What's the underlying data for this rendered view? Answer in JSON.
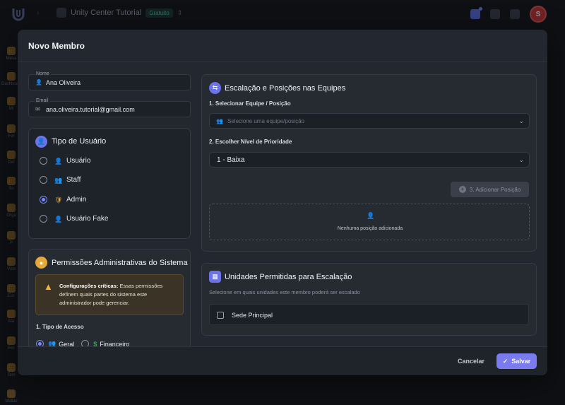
{
  "app": {
    "workspace_name": "Unity Center Tutorial",
    "plan_badge": "Gratuito",
    "avatar_initial": "S",
    "sidebar_items": [
      "Mesa",
      "Dashboard",
      "Mi",
      "Fer",
      "Def",
      "Su",
      "Orga",
      "P",
      "Víde",
      "Esc",
      "Ma",
      "Em",
      "Tem",
      "Midias"
    ]
  },
  "modal": {
    "title": "Novo Membro",
    "name_field": {
      "label": "Nome",
      "value": "Ana Oliveira"
    },
    "email_field": {
      "label": "Email",
      "value": "ana.oliveira.tutorial@gmail.com"
    },
    "user_type": {
      "title": "Tipo de Usuário",
      "options": [
        {
          "label": "Usuário",
          "selected": false,
          "icon": "user-icon",
          "color": "#6c8cff"
        },
        {
          "label": "Staff",
          "selected": false,
          "icon": "staff-icon",
          "color": "#4fb3e0"
        },
        {
          "label": "Admin",
          "selected": true,
          "icon": "shield-icon",
          "color": "#e5a83a"
        },
        {
          "label": "Usuário Fake",
          "selected": false,
          "icon": "user-x-icon",
          "color": "#e05a5c"
        }
      ]
    },
    "permissions": {
      "title": "Permissões Administrativas do Sistema",
      "warning_strong": "Configurações críticas:",
      "warning_text": " Essas permissões definem quais partes do sistema este administrador pode gerenciar.",
      "access_label": "1. Tipo de Acesso",
      "access_options": [
        {
          "label": "Geral",
          "selected": true
        },
        {
          "label": "Financeiro",
          "selected": false
        }
      ]
    },
    "teams": {
      "title": "Escalação e Posições nas Equipes",
      "step1_label": "1. Selecionar Equipe / Posição",
      "step1_placeholder": "Selecione uma equipe/posição",
      "step2_label": "2. Escolher Nível de Prioridade",
      "step2_value": "1 - Baixa",
      "add_button": "3. Adicionar Posição",
      "empty_text": "Nenhuma posição adicionada"
    },
    "units": {
      "title": "Unidades Permitidas para Escalação",
      "description": "Selecione em quais unidades este membro poderá ser escalado",
      "items": [
        {
          "label": "Sede Principal",
          "checked": false
        }
      ]
    },
    "footer": {
      "cancel_label": "Cancelar",
      "save_label": "Salvar"
    }
  },
  "colors": {
    "accent": "#7b7bf0",
    "warning": "#f1b73a",
    "danger": "#c6373a"
  }
}
